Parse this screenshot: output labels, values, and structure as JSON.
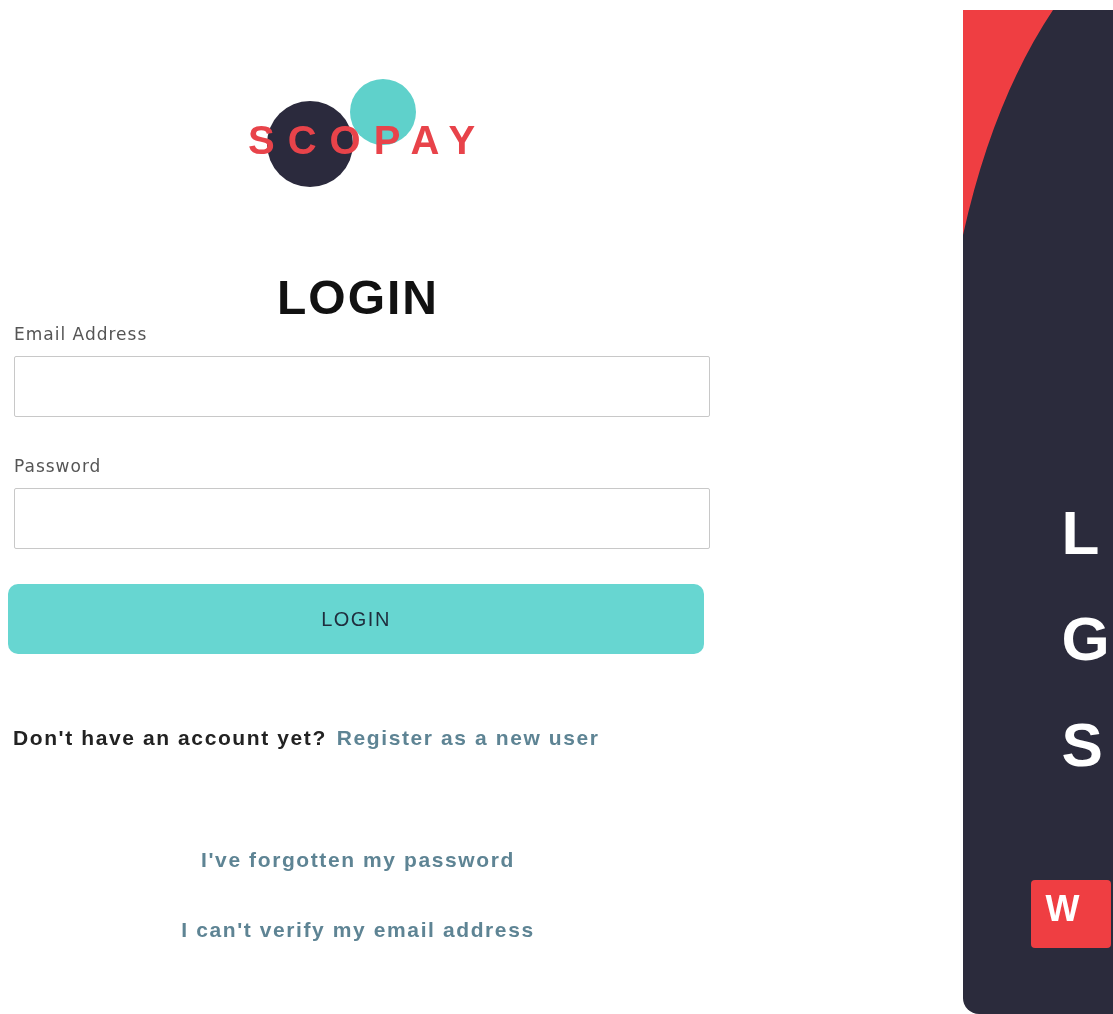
{
  "logo": {
    "text": "SCOPAY"
  },
  "heading": "LOGIN",
  "fields": [
    {
      "label": "Email Address"
    },
    {
      "label": "Password"
    }
  ],
  "login_button": "LOGIN",
  "register": {
    "prompt": "Don't have an account yet?",
    "link": "Register as a new user"
  },
  "links": [
    "I've forgotten my password",
    "I can't verify my email address"
  ],
  "promo": {
    "lines": [
      "L",
      "G",
      "S"
    ],
    "badge": "W"
  }
}
